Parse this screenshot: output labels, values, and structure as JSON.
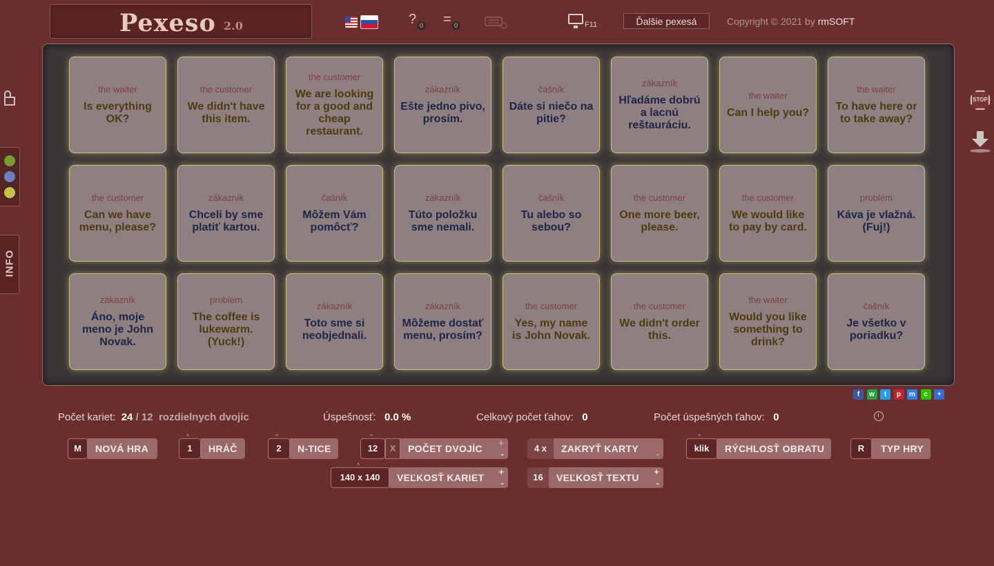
{
  "header": {
    "title": "Pexeso",
    "version": "2.0",
    "help_icon": "?",
    "help_count": "0",
    "list_icon": "=",
    "list_count": "0",
    "fullscreen_key": "F11",
    "more_button": "Ďalšie pexesá",
    "copyright_prefix": "Copyright © 2021 by ",
    "copyright_brand": "rmSOFT"
  },
  "sidebar": {
    "info_label": "INFO",
    "stop_label": "STOP",
    "theme_colors": [
      "#7a9a30",
      "#6f7fbf",
      "#c9c24a"
    ]
  },
  "board": {
    "rows": [
      [
        {
          "cat": "the waiter",
          "text": "Is everything OK?",
          "lang": "en"
        },
        {
          "cat": "the customer",
          "text": "We didn't have this item.",
          "lang": "en"
        },
        {
          "cat": "the customer",
          "text": "We are looking for a good and cheap restaurant.",
          "lang": "en"
        },
        {
          "cat": "zákazník",
          "text": "Ešte jedno pivo, prosím.",
          "lang": "sk"
        },
        {
          "cat": "čašník",
          "text": "Dáte si niečo na pitie?",
          "lang": "sk"
        },
        {
          "cat": "zákazník",
          "text": "Hľadáme dobrú a lacnú reštauráciu.",
          "lang": "sk"
        },
        {
          "cat": "the waiter",
          "text": "Can I help you?",
          "lang": "en"
        },
        {
          "cat": "the waiter",
          "text": "To have here or to take away?",
          "lang": "en"
        }
      ],
      [
        {
          "cat": "the customer",
          "text": "Can we have menu, please?",
          "lang": "en"
        },
        {
          "cat": "zákazník",
          "text": "Chceli by sme platiť kartou.",
          "lang": "sk"
        },
        {
          "cat": "čašník",
          "text": "Môžem Vám pomôcť?",
          "lang": "sk"
        },
        {
          "cat": "zákazník",
          "text": "Túto položku sme nemali.",
          "lang": "sk"
        },
        {
          "cat": "čašník",
          "text": "Tu alebo so sebou?",
          "lang": "sk"
        },
        {
          "cat": "the customer",
          "text": "One more beer, please.",
          "lang": "en"
        },
        {
          "cat": "the customer",
          "text": "We would like to pay by card.",
          "lang": "en"
        },
        {
          "cat": "problém",
          "text": "Káva je vlažná. (Fuj!)",
          "lang": "sk"
        }
      ],
      [
        {
          "cat": "zákazník",
          "text": "Áno, moje meno je John Novak.",
          "lang": "sk"
        },
        {
          "cat": "problem",
          "text": "The coffee is lukewarm. (Yuck!)",
          "lang": "en"
        },
        {
          "cat": "zákazník",
          "text": "Toto sme si neobjednali.",
          "lang": "sk"
        },
        {
          "cat": "zákazník",
          "text": "Môžeme dostať menu, prosím?",
          "lang": "sk"
        },
        {
          "cat": "the customer",
          "text": "Yes, my name is John Novak.",
          "lang": "en"
        },
        {
          "cat": "the customer",
          "text": "We didn't order this.",
          "lang": "en"
        },
        {
          "cat": "the waiter",
          "text": "Would you like something to drink?",
          "lang": "en"
        },
        {
          "cat": "čašník",
          "text": "Je všetko v poriadku?",
          "lang": "sk"
        }
      ]
    ]
  },
  "stats": {
    "cards_label": "Počet kariet:",
    "cards_value": "24",
    "cards_sep": "/",
    "pairs_value": "12",
    "pairs_label": "rozdielnych dvojíc",
    "success_label": "Úspešnosť:",
    "success_value": "0.0 %",
    "moves_label": "Celkový počet ťahov:",
    "moves_value": "0",
    "good_moves_label": "Počet úspešných ťahov:",
    "good_moves_value": "0"
  },
  "controls": {
    "new_game": {
      "key": "M",
      "label": "NOVÁ HRA"
    },
    "player": {
      "key": "1",
      "label": "HRÁČ"
    },
    "ntice": {
      "key": "2",
      "label": "N-TICE"
    },
    "pairs": {
      "key": "12",
      "x": "X",
      "label": "POČET DVOJÍC",
      "plus": "+",
      "minus": "-"
    },
    "hide": {
      "key": "4 x",
      "label": "ZAKRYŤ KARTY",
      "minus": "-"
    },
    "speed": {
      "key": "klik",
      "label": "RÝCHLOSŤ OBRATU"
    },
    "type": {
      "key": "R",
      "label": "TYP HRY"
    },
    "card_size": {
      "key": "140 x 140",
      "label": "VEĽKOSŤ KARIET",
      "plus": "+",
      "minus": "-"
    },
    "text_size": {
      "key": "16",
      "label": "VEĽKOSŤ TEXTU",
      "plus": "+",
      "minus": "-"
    }
  },
  "share": [
    {
      "icon": "facebook-icon",
      "glyph": "f",
      "color": "#3b5998"
    },
    {
      "icon": "whatsapp-icon",
      "glyph": "w",
      "color": "#25a244"
    },
    {
      "icon": "twitter-icon",
      "glyph": "t",
      "color": "#1da1f2"
    },
    {
      "icon": "pinterest-icon",
      "glyph": "p",
      "color": "#c8232c"
    },
    {
      "icon": "messenger-icon",
      "glyph": "m",
      "color": "#2e7ff0"
    },
    {
      "icon": "wechat-icon",
      "glyph": "c",
      "color": "#2dc100"
    },
    {
      "icon": "share-plus-icon",
      "glyph": "+",
      "color": "#2e6fe0"
    }
  ]
}
